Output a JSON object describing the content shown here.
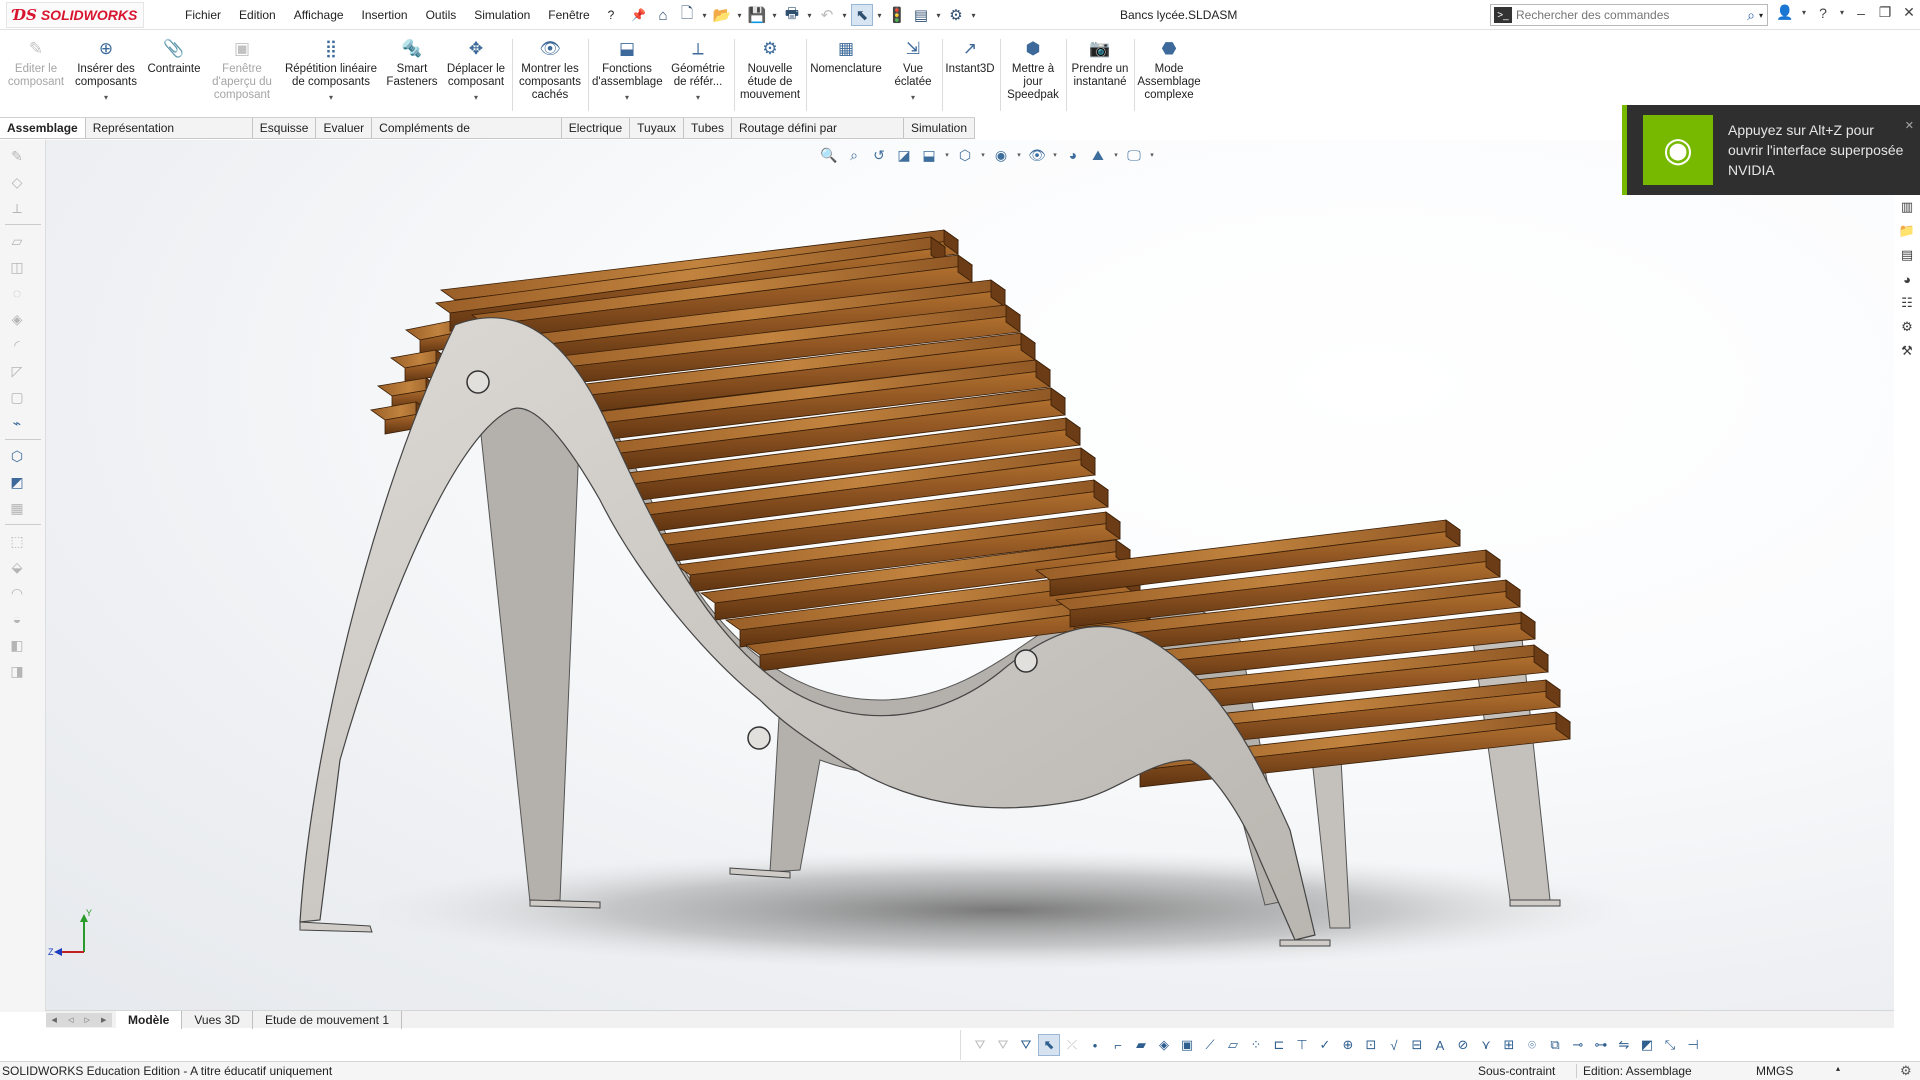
{
  "app": {
    "brand": "SOLIDWORKS",
    "doc_title": "Bancs lycée.SLDASM"
  },
  "menu": {
    "items": [
      "Fichier",
      "Edition",
      "Affichage",
      "Insertion",
      "Outils",
      "Simulation",
      "Fenêtre",
      "?"
    ]
  },
  "search": {
    "placeholder": "Rechercher des commandes"
  },
  "commands": {
    "edit_component": "Editer le composant",
    "insert_components": "Insérer des composants",
    "mate": "Contrainte",
    "preview_window": "Fenêtre d'aperçu du composant",
    "linear_pattern": "Répétition linéaire de composants",
    "smart_fasteners": "Smart Fasteners",
    "move_component": "Déplacer le composant",
    "show_hidden": "Montrer les composants cachés",
    "assembly_features": "Fonctions d'assemblage",
    "reference_geometry": "Géométrie de référ...",
    "new_motion_study": "Nouvelle étude de mouvement",
    "bom": "Nomenclature",
    "exploded_view": "Vue éclatée",
    "instant3d": "Instant3D",
    "update_speedpak": "Mettre à jour Speedpak",
    "snapshot": "Prendre un instantané",
    "large_assembly": "Mode Assemblage complexe"
  },
  "tabs": [
    "Assemblage",
    "Représentation schématique",
    "Esquisse",
    "Evaluer",
    "Compléments de SOLIDWORKS",
    "Electrique",
    "Tuyaux",
    "Tubes",
    "Routage défini par l'utilisateur",
    "Simulation"
  ],
  "active_tab": "Assemblage",
  "toast": {
    "message": "Appuyez sur Alt+Z pour ouvrir l'interface superposée NVIDIA",
    "accent": "#76b900"
  },
  "model_tabs": [
    "Modèle",
    "Vues 3D",
    "Etude de mouvement 1"
  ],
  "status": {
    "edition": "SOLIDWORKS Education Edition - A titre éducatif uniquement",
    "constraint": "Sous-contraint",
    "editing": "Edition: Assemblage",
    "units": "MMGS"
  },
  "triad": {
    "y": "Y",
    "z": "Z"
  },
  "colors": {
    "brand": "#d8152f",
    "wood": "#8a5220",
    "metal": "#c9c6c2"
  }
}
